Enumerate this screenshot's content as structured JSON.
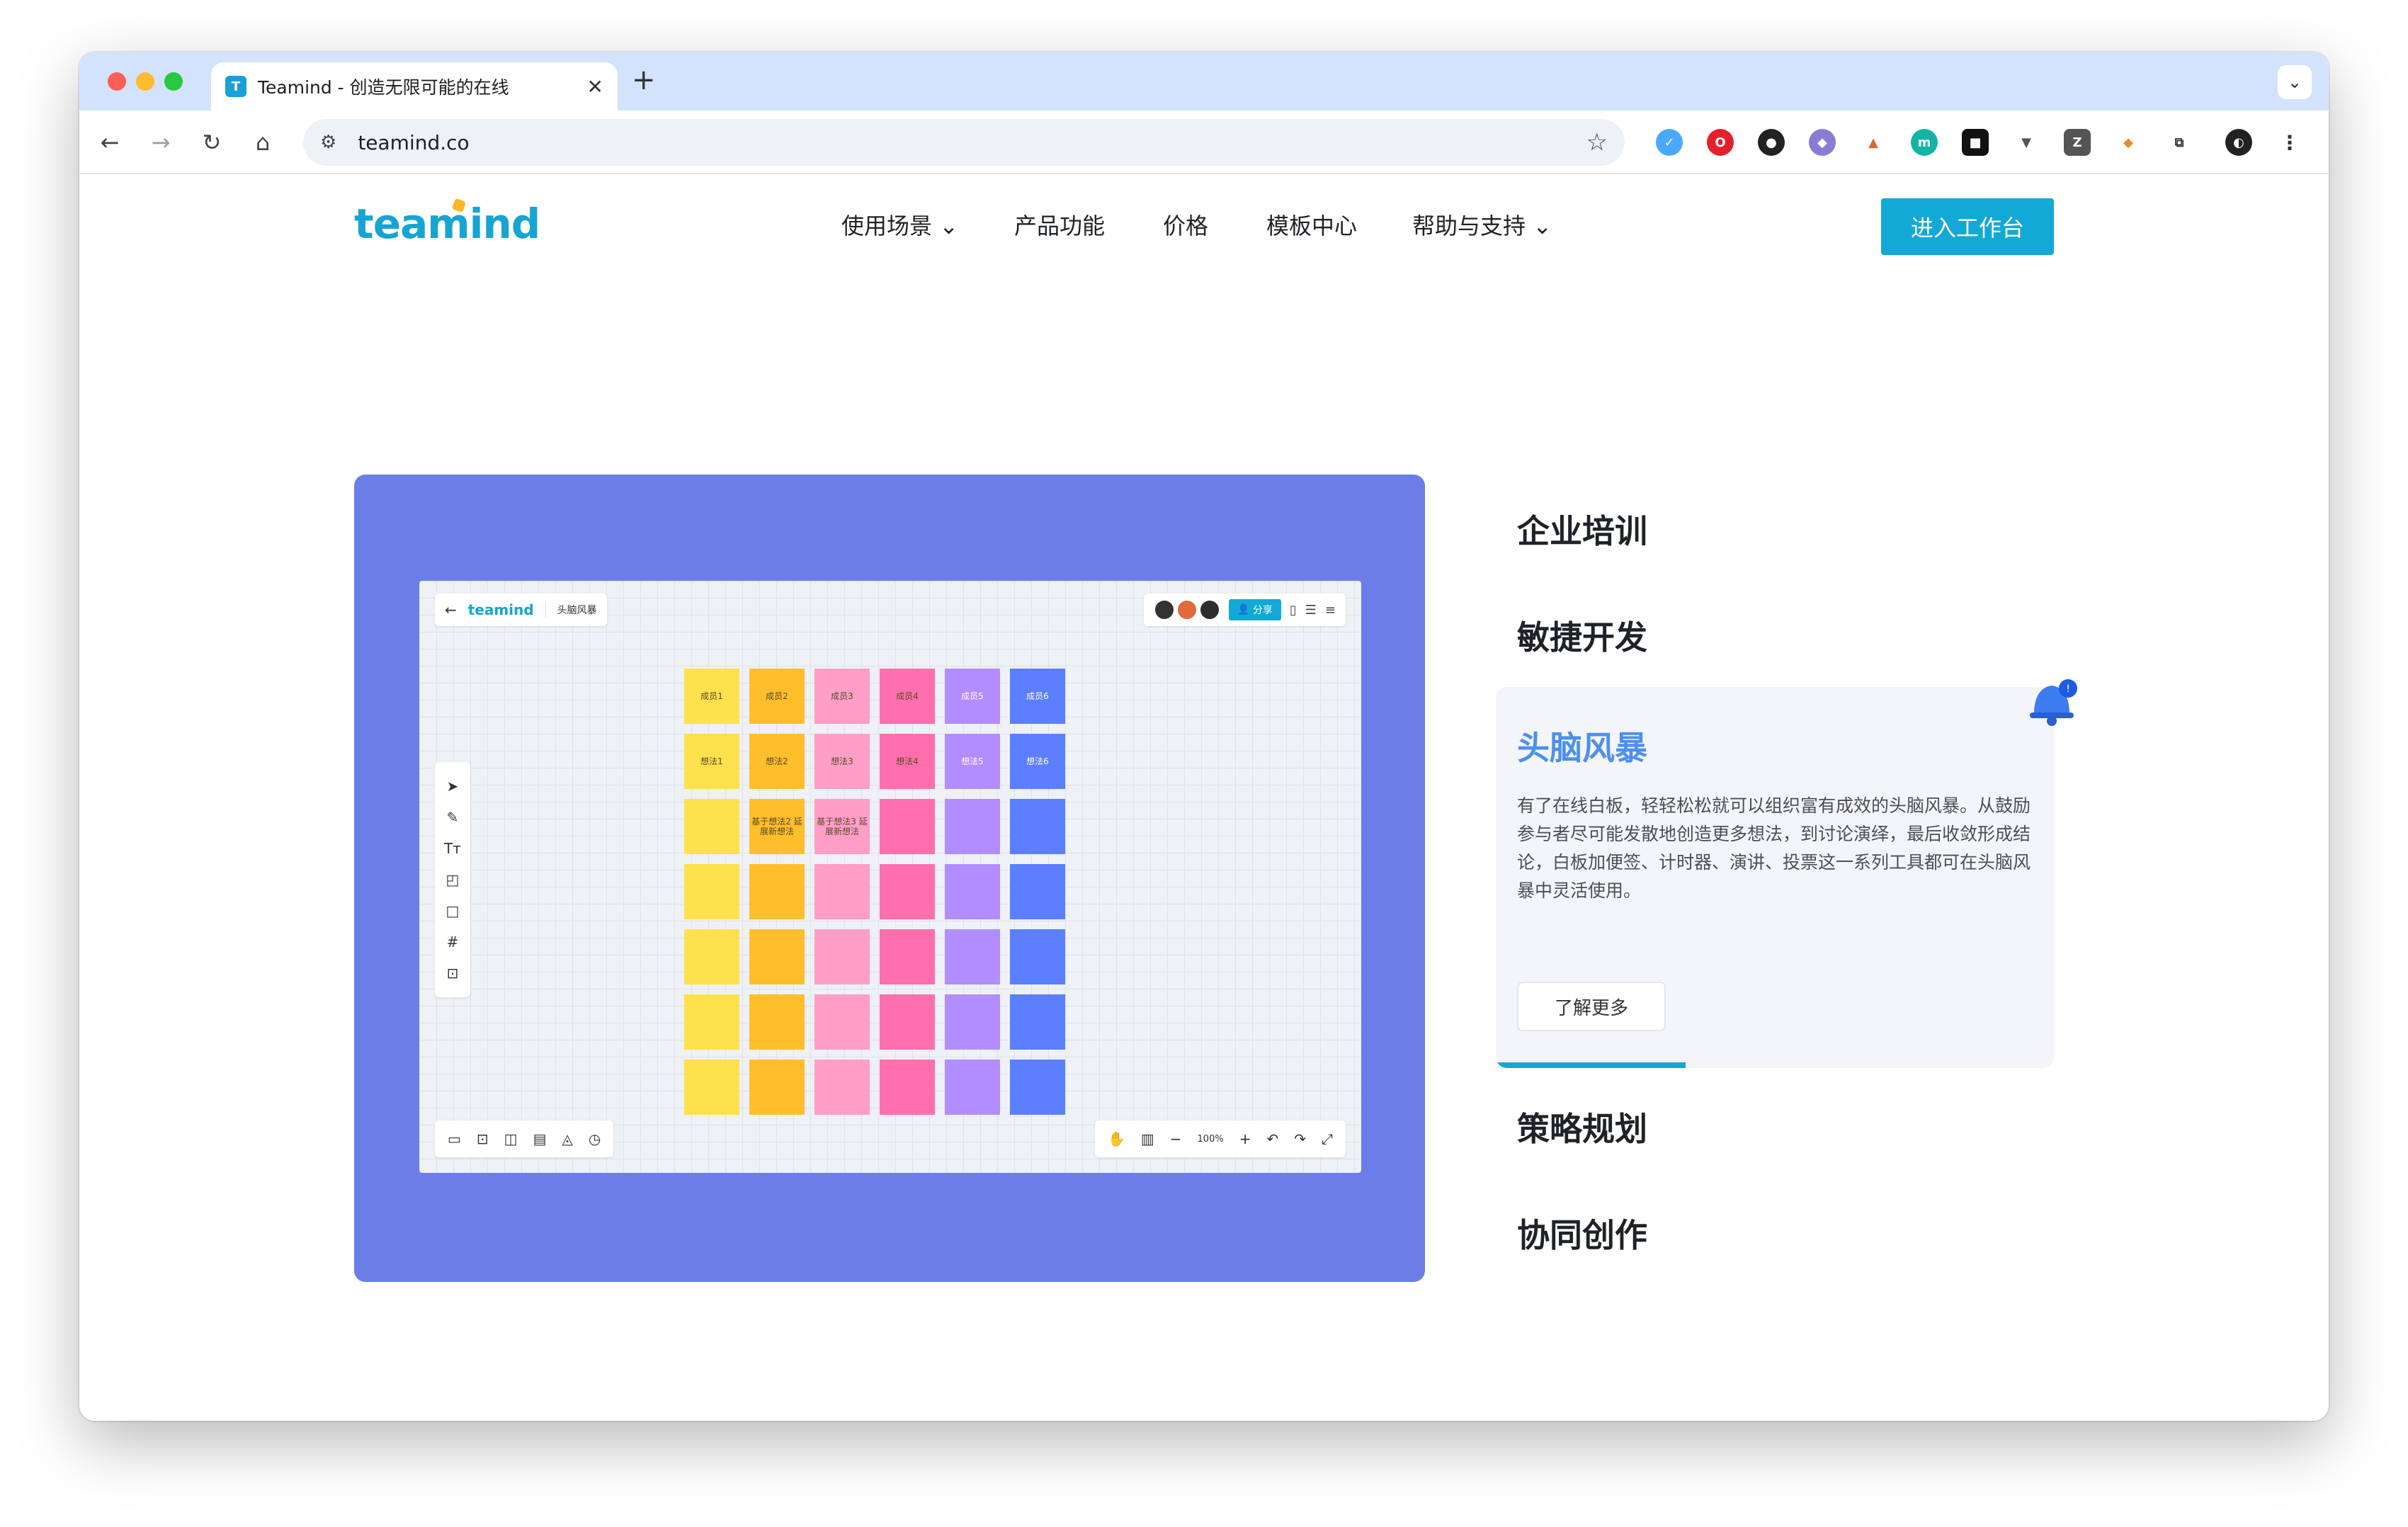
{
  "browser": {
    "tab": {
      "title": "Teamind - 创造无限可能的在线",
      "favicon": "T"
    },
    "address": "teamind.co"
  },
  "site": {
    "logo": "teamind",
    "nav": [
      {
        "label": "使用场景",
        "dropdown": true
      },
      {
        "label": "产品功能",
        "dropdown": false
      },
      {
        "label": "价格",
        "dropdown": false
      },
      {
        "label": "模板中心",
        "dropdown": false
      },
      {
        "label": "帮助与支持",
        "dropdown": true
      }
    ],
    "cta": "进入工作台"
  },
  "board": {
    "logo": "teamind",
    "name": "头脑风暴",
    "share": "分享",
    "zoom": "100%",
    "row1": [
      "成员1",
      "成员2",
      "成员3",
      "成员4",
      "成员5",
      "成员6"
    ],
    "row2": [
      "想法1",
      "想法2",
      "想法3",
      "想法4",
      "想法5",
      "想法6"
    ],
    "row3": [
      "",
      "基于想法2 延展新想法",
      "基于想法3 延展新想法",
      "",
      "",
      ""
    ],
    "colors": [
      "#ffe04d",
      "#ffbe2b",
      "#ff9ec6",
      "#ff6fae",
      "#b28dff",
      "#5b7fff"
    ]
  },
  "features": {
    "f1": "企业培训",
    "f2": "敏捷开发",
    "active": {
      "title": "头脑风暴",
      "desc": "有了在线白板，轻轻松松就可以组织富有成效的头脑风暴。从鼓励参与者尽可能发散地创造更多想法，到讨论演绎，最后收敛形成结论，白板加便签、计时器、演讲、投票这一系列工具都可在头脑风暴中灵活使用。",
      "button": "了解更多",
      "progress": 0.34
    },
    "f4": "策略规划",
    "f5": "协同创作"
  }
}
